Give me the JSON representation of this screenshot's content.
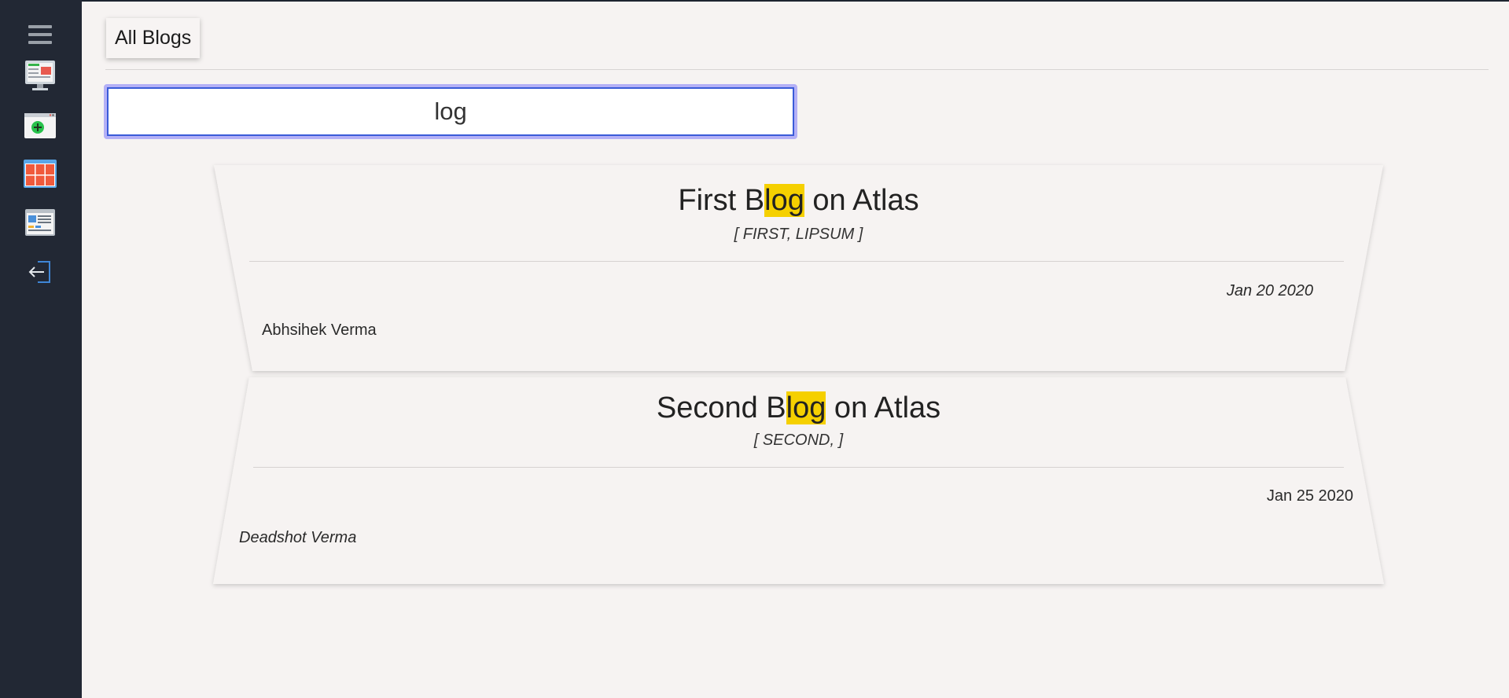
{
  "sidebar": {
    "items": [
      {
        "icon": "menu-icon"
      },
      {
        "icon": "dashboard-monitor-icon"
      },
      {
        "icon": "add-blog-icon"
      },
      {
        "icon": "grid-view-icon"
      },
      {
        "icon": "article-view-icon"
      },
      {
        "icon": "logout-icon"
      }
    ]
  },
  "header": {
    "tab_label": "All Blogs"
  },
  "search": {
    "value": "log",
    "highlight_color": "#f5d000"
  },
  "blogs": [
    {
      "title_pre": "First B",
      "title_match": "log",
      "title_post": " on Atlas",
      "tags": "[ FIRST, LIPSUM ]",
      "date": "Jan 20 2020",
      "author": "Abhsihek Verma"
    },
    {
      "title_pre": "Second B",
      "title_match": "log",
      "title_post": " on Atlas",
      "tags": "[ SECOND, ]",
      "date": "Jan 25 2020",
      "author": "Deadshot Verma"
    }
  ],
  "colors": {
    "sidebar_bg": "#222834",
    "page_bg": "#f6f3f2",
    "search_focus_ring": "#b4b0f6"
  }
}
